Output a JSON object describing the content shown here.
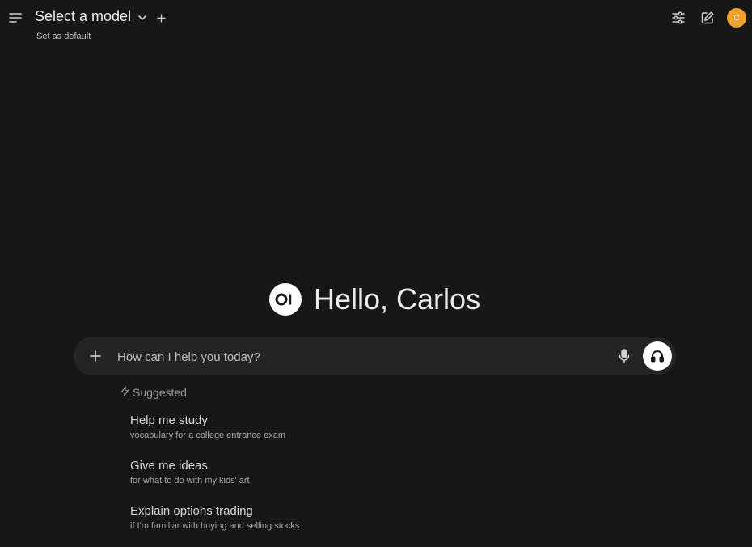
{
  "header": {
    "model_title": "Select a model",
    "set_default": "Set as default",
    "avatar_initial": "C"
  },
  "hero": {
    "logo_text": "OI",
    "greeting": "Hello, Carlos"
  },
  "composer": {
    "placeholder": "How can I help you today?"
  },
  "suggestions": {
    "heading": "Suggested",
    "items": [
      {
        "title": "Help me study",
        "subtitle": "vocabulary for a college entrance exam"
      },
      {
        "title": "Give me ideas",
        "subtitle": "for what to do with my kids' art"
      },
      {
        "title": "Explain options trading",
        "subtitle": "if I'm familiar with buying and selling stocks"
      }
    ]
  },
  "colors": {
    "background": "#171717",
    "composer_bg": "#242424",
    "avatar_bg": "#f0a22e"
  }
}
